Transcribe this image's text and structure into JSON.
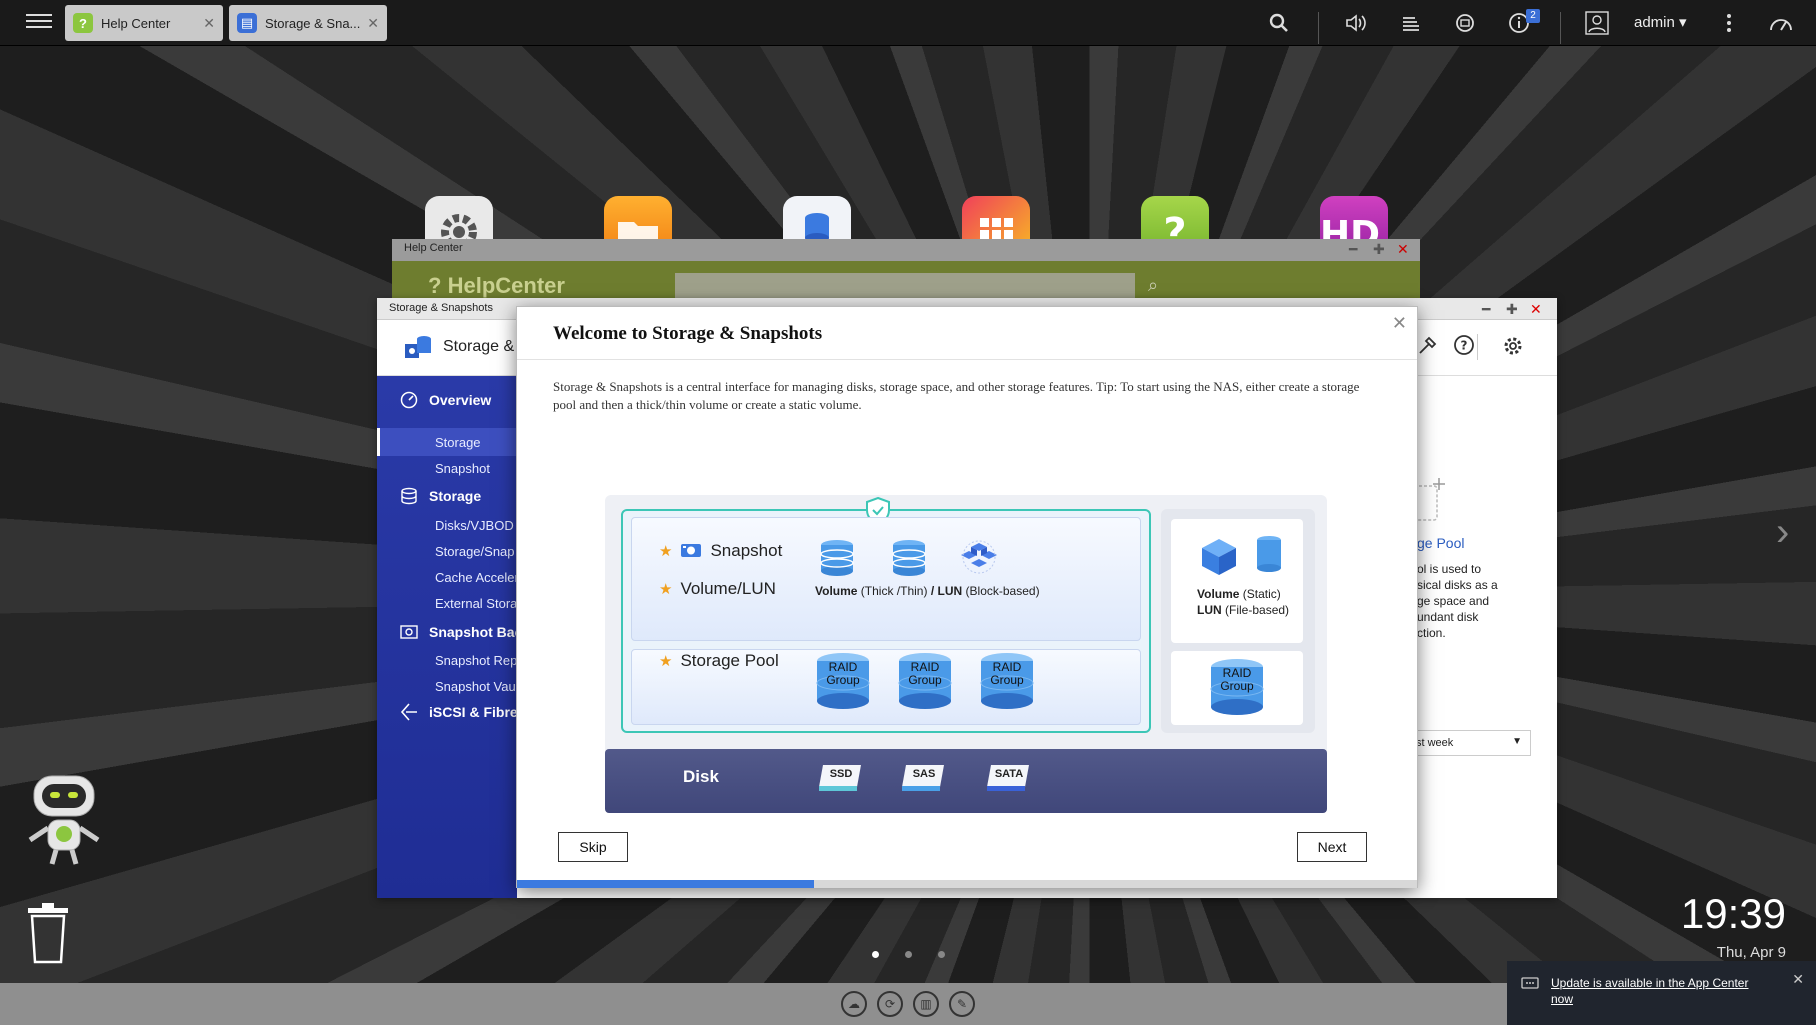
{
  "taskbar": {
    "tabs": [
      {
        "label": "Help Center",
        "icon": "help-center-icon"
      },
      {
        "label": "Storage & Sna...",
        "icon": "storage-snapshots-icon"
      }
    ],
    "user": "admin",
    "notification_count": "2"
  },
  "help_window": {
    "title": "Help Center",
    "brand": "HelpCenter"
  },
  "storage_window": {
    "title": "Storage & Snapshots",
    "app_title": "Storage &",
    "sidebar": {
      "overview": "Overview",
      "overview_items": [
        "Storage",
        "Snapshot"
      ],
      "storage": "Storage",
      "storage_items": [
        "Disks/VJBOD",
        "Storage/Snap",
        "Cache Acceler",
        "External Stora"
      ],
      "snapshot_backup": "Snapshot Bac",
      "snapshot_backup_items": [
        "Snapshot Rep",
        "Snapshot Vau"
      ],
      "iscsi": "iSCSI & Fibre C"
    },
    "right_panel": {
      "title_tail": "ge Pool",
      "text_lines": [
        "ol is used to",
        "sical disks as a",
        "ge space and",
        "undant disk",
        "ction."
      ],
      "select_value": "st week"
    }
  },
  "dialog": {
    "title": "Welcome to Storage & Snapshots",
    "description": "Storage & Snapshots is a central interface for managing disks, storage space, and other storage features. Tip: To start using the NAS, either create a storage pool and then a thick/thin volume or create a static volume.",
    "diagram": {
      "snapshot": "Snapshot",
      "volume_lun": "Volume/LUN",
      "storage_pool": "Storage Pool",
      "volume_label": "Volume",
      "volume_type": "(Thick /Thin)",
      "lun_sep": "/",
      "lun_label": "LUN",
      "lun_type": "(Block-based)",
      "static_volume": "Volume",
      "static_volume_type": "(Static)",
      "static_lun": "LUN",
      "static_lun_type": "(File-based)",
      "raid_line1": "RAID",
      "raid_line2": "Group",
      "disk": "Disk",
      "disk_types": [
        "SSD",
        "SAS",
        "SATA"
      ]
    },
    "skip_label": "Skip",
    "next_label": "Next",
    "progress": 0.33
  },
  "clock": {
    "time": "19:39",
    "date": "Thu, Apr 9"
  },
  "toast": {
    "message": "Update is available in the App Center now"
  },
  "colors": {
    "accent_blue": "#3b7ae0",
    "sidebar_blue": "#2a3aa8",
    "teal_border": "#3cc6b6",
    "star_orange": "#f0a020",
    "help_green": "#6e7d2f"
  }
}
